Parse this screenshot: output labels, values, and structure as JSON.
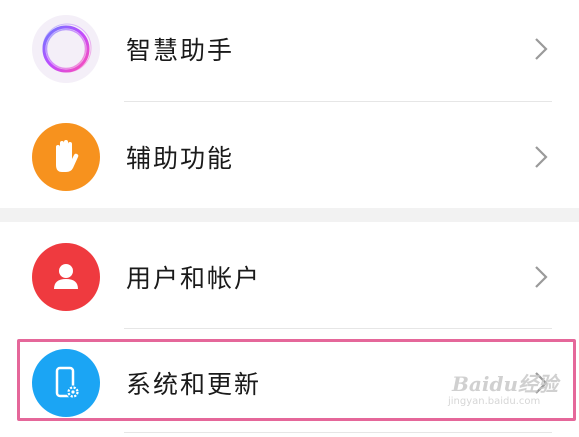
{
  "settings": {
    "items": [
      {
        "label": "智慧助手",
        "icon": "assistant-ring-icon",
        "color": "#f3eef8"
      },
      {
        "label": "辅助功能",
        "icon": "hand-icon",
        "color": "#f7921e"
      },
      {
        "label": "用户和帐户",
        "icon": "user-icon",
        "color": "#ef3a3f"
      },
      {
        "label": "系统和更新",
        "icon": "phone-gear-icon",
        "color": "#1ba5f4"
      }
    ],
    "chevron_icon": "chevron-right-icon"
  },
  "highlight": {
    "color": "#e5679a"
  },
  "watermark": {
    "text": "Baidu经验",
    "sub": "jingyan.baidu.com"
  }
}
